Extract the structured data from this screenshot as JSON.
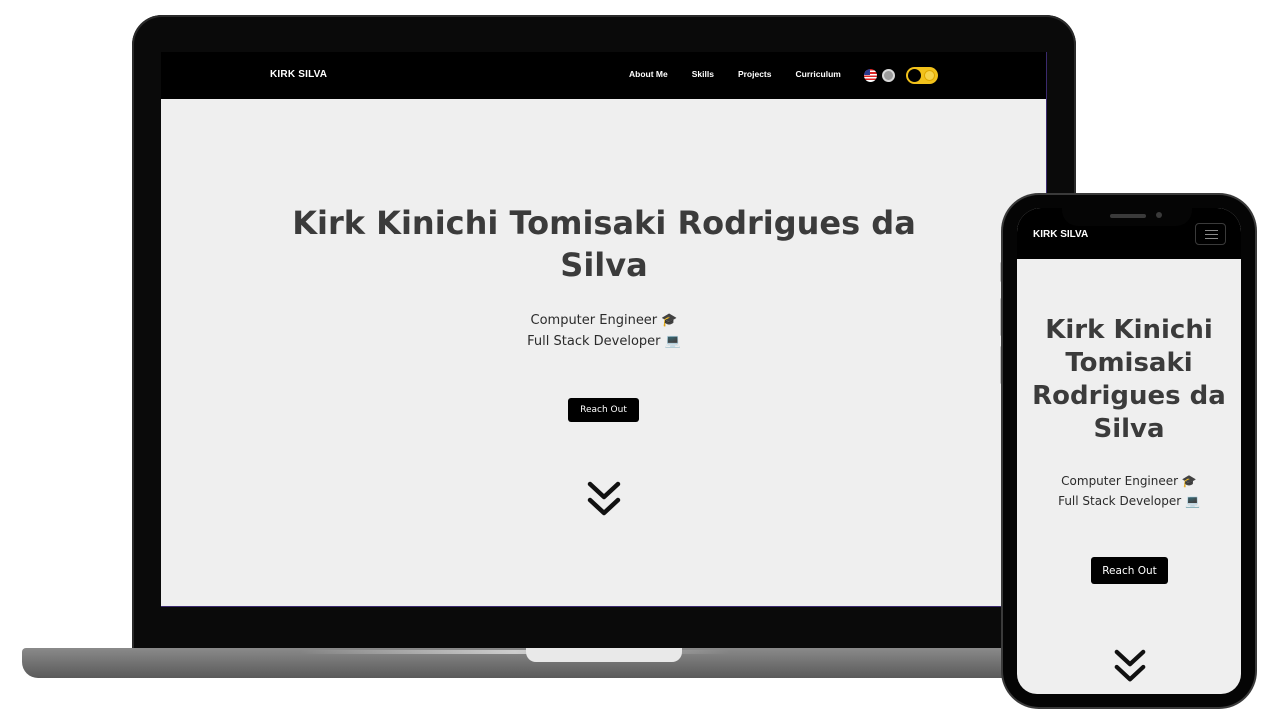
{
  "desktop": {
    "brand": "KIRK SILVA",
    "nav": [
      {
        "label": "About Me"
      },
      {
        "label": "Skills"
      },
      {
        "label": "Projects"
      },
      {
        "label": "Curriculum"
      }
    ],
    "hero": {
      "title": "Kirk Kinichi Tomisaki Rodrigues da Silva",
      "subtitle_line1": "Computer Engineer 🎓",
      "subtitle_line2": "Full Stack Developer 💻",
      "cta": "Reach Out"
    },
    "icons": {
      "flag_en": "us-flag-icon",
      "flag_other": "language-flag-icon",
      "theme_toggle": "theme-toggle-icon",
      "scroll": "double-chevron-down-icon"
    },
    "colors": {
      "nav_bg": "#000000",
      "page_bg": "#efefef",
      "toggle": "#f2c21b",
      "text": "#3b3b3b"
    }
  },
  "mobile": {
    "brand": "KIRK SILVA",
    "hero": {
      "title": "Kirk Kinichi Tomisaki Rodrigues da Silva",
      "subtitle_line1": "Computer Engineer 🎓",
      "subtitle_line2": "Full Stack Developer 💻",
      "cta": "Reach Out"
    },
    "icons": {
      "menu": "hamburger-menu-icon",
      "scroll": "double-chevron-down-icon"
    }
  }
}
